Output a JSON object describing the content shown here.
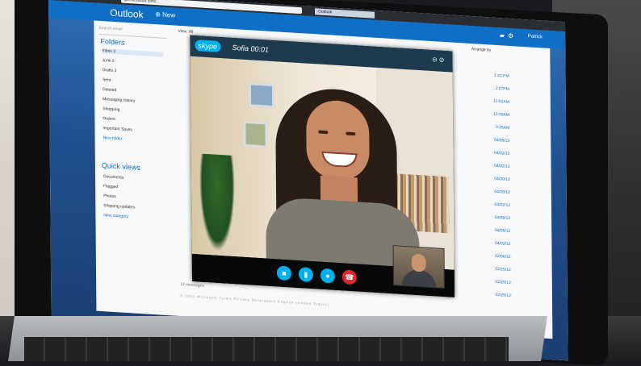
{
  "browser": {
    "url_text": "go.microsoft.com/...",
    "tab_label": "Outlook"
  },
  "app": {
    "brand": "Outlook",
    "new_label": "New",
    "user_name": "Patrick",
    "accent": "#0f6fc6"
  },
  "sidebar": {
    "search_placeholder": "Search email",
    "folders_title": "Folders",
    "folders": [
      {
        "label": "Inbox",
        "count": "3"
      },
      {
        "label": "Junk",
        "count": "2"
      },
      {
        "label": "Drafts",
        "count": "3"
      },
      {
        "label": "Sent",
        "count": ""
      },
      {
        "label": "Deleted",
        "count": ""
      },
      {
        "label": "Messaging history",
        "count": ""
      },
      {
        "label": "Shopping",
        "count": ""
      },
      {
        "label": "Orders",
        "count": ""
      },
      {
        "label": "Important Saves",
        "count": ""
      },
      {
        "label": "New folder",
        "count": ""
      }
    ],
    "quick_views_title": "Quick views",
    "quick_views": [
      {
        "label": "Documents"
      },
      {
        "label": "Flagged"
      },
      {
        "label": "Photos"
      },
      {
        "label": "Shipping updates"
      },
      {
        "label": "New category"
      }
    ]
  },
  "message_list": {
    "view_label": "View: All",
    "arrange_label": "Arrange by",
    "times": [
      "1:43 PM",
      "1:27PM",
      "11:52AM",
      "11:00AM",
      "9:25AM",
      "04/06/13",
      "04/02/13",
      "04/02/13",
      "04/30/12",
      "04/08/12",
      "04/02/12",
      "04/08/12",
      "04/06/12",
      "04/02/12",
      "02/06/12",
      "02/25/12",
      "02/25/12",
      "02/25/12"
    ],
    "footer_text": "13 messages",
    "footer_links": "© 2012 Microsoft   Terms   Privacy   Developers   English (United States)"
  },
  "skype": {
    "logo_text": "skype",
    "caller": "Sofia",
    "duration": "00:01",
    "controls": [
      "video",
      "mic",
      "chat",
      "end-call"
    ],
    "accent": "#00aff0",
    "end_color": "#e0272b"
  }
}
